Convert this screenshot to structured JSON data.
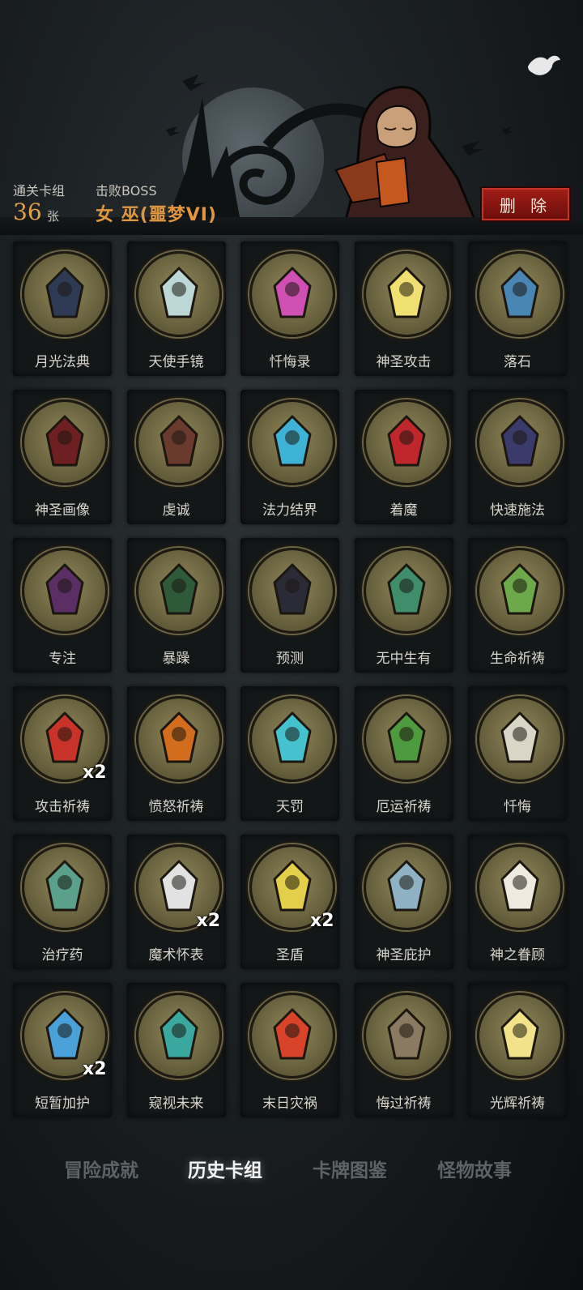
{
  "header": {
    "cleared_deck_label": "通关卡组",
    "card_count": "36",
    "card_unit": "张",
    "boss_label": "击败BOSS",
    "boss_name": "女 巫(噩梦VI)",
    "delete_label": "删 除"
  },
  "cards": [
    {
      "name": "月光法典",
      "mult": "",
      "color": "#7a7346",
      "accent": "#2f3b54"
    },
    {
      "name": "天使手镜",
      "mult": "",
      "color": "#7a7346",
      "accent": "#bcd7d6"
    },
    {
      "name": "忏悔录",
      "mult": "",
      "color": "#7a7346",
      "accent": "#d04fb2"
    },
    {
      "name": "神圣攻击",
      "mult": "",
      "color": "#7a7346",
      "accent": "#f0e072"
    },
    {
      "name": "落石",
      "mult": "",
      "color": "#7a7346",
      "accent": "#4a86b4"
    },
    {
      "name": "神圣画像",
      "mult": "",
      "color": "#7a7346",
      "accent": "#6d1f22"
    },
    {
      "name": "虔诚",
      "mult": "",
      "color": "#7a7346",
      "accent": "#6a3a2f"
    },
    {
      "name": "法力结界",
      "mult": "",
      "color": "#7a7346",
      "accent": "#3fb3d6"
    },
    {
      "name": "着魔",
      "mult": "",
      "color": "#7a7346",
      "accent": "#c0272d"
    },
    {
      "name": "快速施法",
      "mult": "",
      "color": "#7a7346",
      "accent": "#3a3a6b"
    },
    {
      "name": "专注",
      "mult": "",
      "color": "#7a7346",
      "accent": "#5b2e66"
    },
    {
      "name": "暴躁",
      "mult": "",
      "color": "#7a7346",
      "accent": "#2f5a3a"
    },
    {
      "name": "预测",
      "mult": "",
      "color": "#7a7346",
      "accent": "#2b2b38"
    },
    {
      "name": "无中生有",
      "mult": "",
      "color": "#7a7346",
      "accent": "#3f8d6b"
    },
    {
      "name": "生命祈祷",
      "mult": "",
      "color": "#7a7346",
      "accent": "#6da84a"
    },
    {
      "name": "攻击祈祷",
      "mult": "x2",
      "color": "#7a7346",
      "accent": "#c9342a"
    },
    {
      "name": "愤怒祈祷",
      "mult": "",
      "color": "#7a7346",
      "accent": "#d26d1e"
    },
    {
      "name": "天罚",
      "mult": "",
      "color": "#7a7346",
      "accent": "#46c2cf"
    },
    {
      "name": "厄运祈祷",
      "mult": "",
      "color": "#7a7346",
      "accent": "#4e9a3e"
    },
    {
      "name": "忏悔",
      "mult": "",
      "color": "#7a7346",
      "accent": "#d9d6c8"
    },
    {
      "name": "治疗药",
      "mult": "",
      "color": "#7a7346",
      "accent": "#5aa08a"
    },
    {
      "name": "魔术怀表",
      "mult": "x2",
      "color": "#7a7346",
      "accent": "#e2e2e2"
    },
    {
      "name": "圣盾",
      "mult": "x2",
      "color": "#7a7346",
      "accent": "#e4cf4a"
    },
    {
      "name": "神圣庇护",
      "mult": "",
      "color": "#7a7346",
      "accent": "#8fb1c4"
    },
    {
      "name": "神之眷顾",
      "mult": "",
      "color": "#7a7346",
      "accent": "#eeeadf"
    },
    {
      "name": "短暂加护",
      "mult": "x2",
      "color": "#7a7346",
      "accent": "#4aa0d8"
    },
    {
      "name": "窥视未来",
      "mult": "",
      "color": "#7a7346",
      "accent": "#3aa89e"
    },
    {
      "name": "末日灾祸",
      "mult": "",
      "color": "#7a7346",
      "accent": "#d8432a"
    },
    {
      "name": "悔过祈祷",
      "mult": "",
      "color": "#7a7346",
      "accent": "#8a7a62"
    },
    {
      "name": "光辉祈祷",
      "mult": "",
      "color": "#7a7346",
      "accent": "#f2e38a"
    }
  ],
  "tabs": [
    {
      "label": "冒险成就",
      "active": false
    },
    {
      "label": "历史卡组",
      "active": true
    },
    {
      "label": "卡牌图鉴",
      "active": false
    },
    {
      "label": "怪物故事",
      "active": false
    }
  ]
}
